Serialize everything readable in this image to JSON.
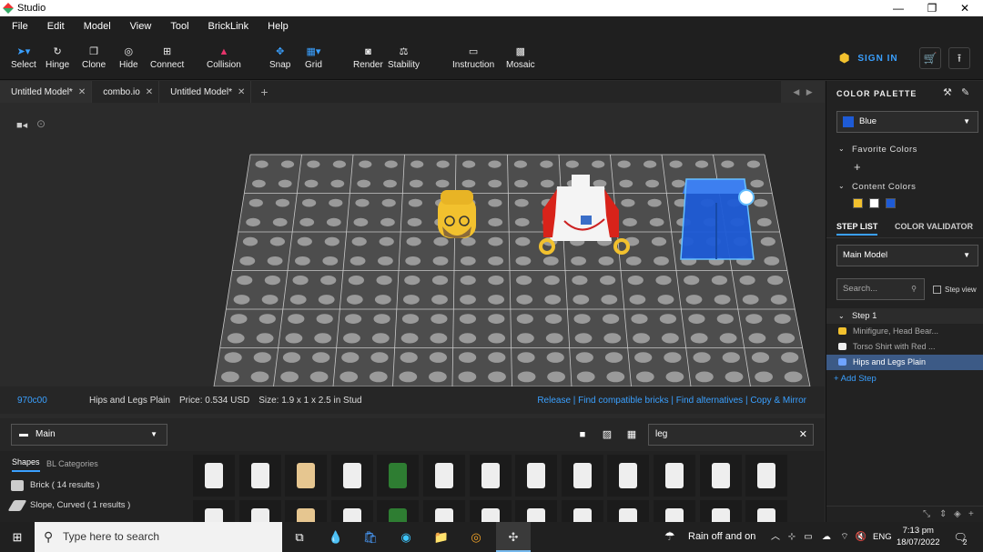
{
  "window": {
    "title": "Studio",
    "minimize": "—",
    "maximize": "❐",
    "close": "✕"
  },
  "menu": [
    "File",
    "Edit",
    "Model",
    "View",
    "Tool",
    "BrickLink",
    "Help"
  ],
  "toolbar": {
    "select": "Select",
    "hinge": "Hinge",
    "clone": "Clone",
    "hide": "Hide",
    "connect": "Connect",
    "collision": "Collision",
    "snap": "Snap",
    "grid": "Grid",
    "render": "Render",
    "stability": "Stability",
    "instruction": "Instruction",
    "mosaic": "Mosaic",
    "sign_in": "SIGN IN"
  },
  "tabs": [
    {
      "label": "Untitled Model*"
    },
    {
      "label": "combo.io"
    },
    {
      "label": "Untitled Model*"
    }
  ],
  "info": {
    "code": "970c00",
    "name": "Hips  and Legs Plain",
    "price": "Price: 0.534 USD",
    "size": "Size: 1.9 x 1 x 2.5 in Stud",
    "links": "Release  |  Find compatible bricks  |  Find alternatives  |  Copy & Mirror"
  },
  "palette": {
    "category": "Main",
    "search_value": "leg",
    "tab_shapes": "Shapes",
    "tab_bl": "BL Categories",
    "shapes": [
      {
        "label": "Brick ( 14 results )"
      },
      {
        "label": "Slope, Curved ( 1 results )"
      }
    ]
  },
  "right": {
    "color_palette_title": "COLOR PALETTE",
    "selected_color": "Blue",
    "favorite_colors": "Favorite Colors",
    "content_colors": "Content Colors",
    "content_swatches": [
      "#f2c12e",
      "#ffffff",
      "#1e5bd6"
    ],
    "tab_step_list": "STEP LIST",
    "tab_color_validator": "COLOR VALIDATOR",
    "model_select": "Main Model",
    "search_placeholder": "Search...",
    "step_view": "Step view",
    "step_title": "Step 1",
    "step_items": [
      {
        "label": "Minifigure, Head Bear..."
      },
      {
        "label": "Torso Shirt with Red ..."
      },
      {
        "label": "Hips  and Legs Plain"
      }
    ],
    "add_step": "+ Add Step"
  },
  "taskbar": {
    "search": "Type here to search",
    "weather": "Rain off and on",
    "lang": "ENG",
    "time": "7:13 pm",
    "date": "18/07/2022",
    "notif": "2"
  },
  "colors": {
    "accent": "#3aa0ff",
    "blue_brick": "#1e5bd6",
    "yellow": "#f2c12e"
  }
}
